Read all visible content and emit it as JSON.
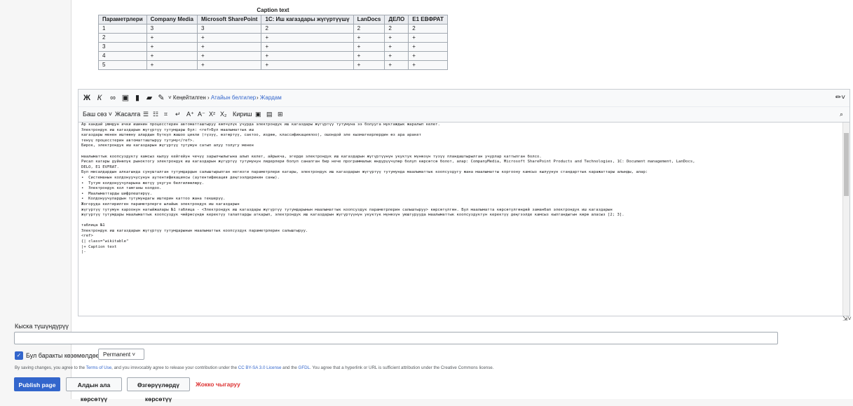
{
  "preview": {
    "caption": "Caption text",
    "headers": [
      "Параметрлери",
      "Company Media",
      "Microsoft SharePoint",
      "1С: Иш кагаздары жүгүртүүшү",
      "LanDocs",
      "ДЕЛО",
      "Е1 ЕВФРАТ"
    ],
    "rows": [
      [
        "1",
        "3",
        "3",
        "2",
        "2",
        "2",
        "2"
      ],
      [
        "2",
        "+",
        "+",
        "+",
        "+",
        "+",
        "+"
      ],
      [
        "3",
        "+",
        "+",
        "+",
        "+",
        "+",
        "+"
      ],
      [
        "4",
        "+",
        "+",
        "+",
        "+",
        "+",
        "+"
      ],
      [
        "5",
        "+",
        "+",
        "+",
        "+",
        "+",
        "+"
      ]
    ]
  },
  "toolbar": {
    "bold": "Ж",
    "italic": "К",
    "advanced": "Кеңейтилген",
    "special": "Атайын белгилер",
    "help": "Жардам",
    "heading": "Баш сөз",
    "format": "Жасалга",
    "insert": "Кириш"
  },
  "editor_lines": [
    "Ар кандай уюмдун ички ишинин процесстерин автоматташтыруу көпчүлүк учурда электрондук иш кагаздары жүгүртүү тутумуна ээ болууга муктаждык жаралып келет.",
    "Электрондук иш кагаздарын жүгүртүү тутумдары бул: <ref>Бул маалыматтык иш",
    "кагаздары менен иштөөнү алардын бүткүл жашоо цикли (түзүү, өзгөртүү, сактоо, издөө, классификациялоо), ошондой эле кызматкерлердин өз ара аракет",
    "тенүү процесстерин автоматташтыруу тутуму</ref>.",
    "Бирок, электрондук иш кагаздарын жүгүртүү тутумун сатып алуу толугу менен",
    "",
    "маалыматтык коопсуздукту камсыз кылуу кейгейүн чечүү зарылчылыгына алып келет, айрыкча, эгерде электрондук иш кагаздарын жүгүртүүнүн укуктук мүнөзүн түзүү пландаштырылган учурлар каттылган болсо.",
    "Рисал катары дүйнөлүк рыноктогу электрондук иш кагаздарын жүгүртүү тутумунун лидерлери болуп саналган бир нече программалык өндүрүүчүлөр болуп көрсөтсө болот, алар: CompanyMedia, Microsoft SharePoint Products and Technologies, 1С: Document management, LanDocs,",
    "DELO, E1 EVFRAT.",
    "Бул мисалдардын алкагында сунушталган тутумдардын салыштырылган негизги параметрлери катары, электрондук иш кагаздарын жүгүртүү тутумунда маалыматтык коопсуздугу жана маалыматты коргоону камсыз кылуунун стандарттык каражаттары алынды, алар:",
    "•  Системанын колдонуучусунун аутентификациясы (аутентификация деңгээлдеринин саны).",
    "•  Тутум колдонуучуларына жетүү укугун белгилөөлөрү.",
    "•  Электрондук кол тамганы колдоо.",
    "•  Маалыматтарды шифрлештирүү.",
    "•  Колдонуучулардын тутумундагы иштерин каттоо жана текшерүү.",
    "Жогоруда келтирилген параметрлерге ылайык электрондук иш кагаздарын",
    "жүгүртүү тутумун кароонун натыйжалары №1 таблица - <Электрондук иш кагаздары жүгүртүү тутумдарынын маалыматтык коопсуздук параметрлерин салыштыруу> көрсөтүлгөн. Бул маалыматта көрсөтүлгөндөй заманбап электрондук иш кагаздарын",
    "жүгүртүү тутумдары маалыматтык коопсуздук чөйрөсүндө керектүү талаптарды аткарып, электрондук иш кагаздарын жүгүртүүнүн укуктук мүнөзүн уюштурууда маалыматтык коопсуздуктун керектүү деңгээлде камсыз кылгандыгын көрө аласыз [2; 3].",
    "",
    "таблица №1",
    "Электрондук иш кагаздарын жүгүртүү тутумдарынын маалыматтык коопсуздук параметрлерин салыштыруу.",
    "<ref>",
    "{| class=\"wikitable\"",
    "|+ Caption text",
    "|-"
  ],
  "summary": {
    "label": "Кыска түшүндүрүү",
    "value": ""
  },
  "watch": {
    "label": "Бул баракты көзөмөлдөө",
    "option": "Permanent"
  },
  "legal": {
    "pre": "By saving changes, you agree to the ",
    "terms": "Terms of Use",
    "mid": ", and you irrevocably agree to release your contribution under the ",
    "license": "CC BY-SA 3.0 License",
    "and": " and the ",
    "gfdl": "GFDL",
    "post": ". You agree that a hyperlink or URL is sufficient attribution under the Creative Commons license."
  },
  "buttons": {
    "publish": "Publish page",
    "preview": "Алдын ала көрсөтүү",
    "changes": "Өзгөрүүлөрдү көрсөтүү",
    "cancel": "Жокко чыгаруу"
  }
}
